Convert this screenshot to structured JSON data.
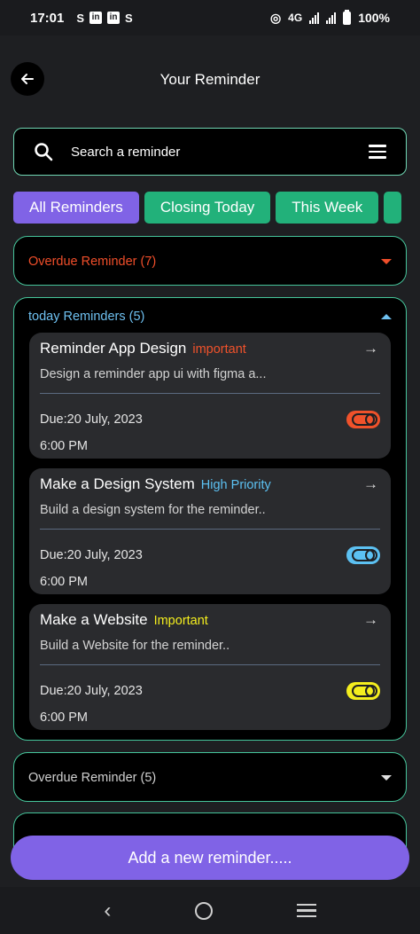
{
  "status": {
    "time": "17:01",
    "network": "4G",
    "battery": "100%"
  },
  "header": {
    "title": "Your Reminder"
  },
  "search": {
    "placeholder": "Search a reminder"
  },
  "tabs": [
    {
      "label": "All Reminders",
      "active": true
    },
    {
      "label": "Closing Today",
      "active": false
    },
    {
      "label": "This Week",
      "active": false
    }
  ],
  "sections": {
    "overdue_top": {
      "label": "Overdue Reminder (7)",
      "color": "#f04e2a"
    },
    "today": {
      "label": "today Reminders (5)",
      "color": "#6ec0f0"
    },
    "overdue_bottom": {
      "label": "Overdue Reminder (5)",
      "color": "#d0d0d0"
    }
  },
  "reminders": [
    {
      "title": "Reminder App Design",
      "tag": "important",
      "tag_color": "#f0522b",
      "description": "Design a reminder app ui with figma a...",
      "due": "Due:20 July, 2023",
      "time": "6:00 PM",
      "toggle_color": "#f0522b"
    },
    {
      "title": "Make a Design System",
      "tag": "High Priority",
      "tag_color": "#5cc1f2",
      "description": "Build a design system for the reminder..",
      "due": "Due:20 July, 2023",
      "time": "6:00 PM",
      "toggle_color": "#5cc1f2"
    },
    {
      "title": "Make a Website",
      "tag": "Important",
      "tag_color": "#f4ee1e",
      "description": "Build a Website for the reminder..",
      "due": "Due:20 July, 2023",
      "time": "6:00 PM",
      "toggle_color": "#f4ee1e"
    }
  ],
  "add_button": {
    "label": "Add a new reminder....."
  },
  "colors": {
    "accent": "#8063e6",
    "tab_green": "#22b17a",
    "border_green": "#45c49a"
  }
}
